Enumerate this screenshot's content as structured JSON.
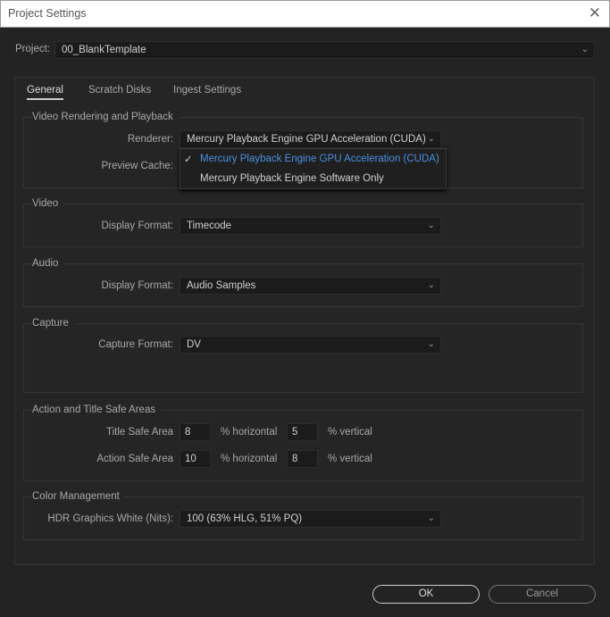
{
  "window": {
    "title": "Project Settings",
    "close_icon": "close-icon"
  },
  "project": {
    "label": "Project:",
    "value": "00_BlankTemplate"
  },
  "tabs": [
    {
      "label": "General",
      "active": true
    },
    {
      "label": "Scratch Disks"
    },
    {
      "label": "Ingest Settings"
    }
  ],
  "video_rendering": {
    "title": "Video Rendering and Playback",
    "renderer_label": "Renderer:",
    "renderer_value": "Mercury Playback Engine GPU Acceleration (CUDA)",
    "preview_cache_label": "Preview Cache:",
    "menu_options": [
      {
        "label": "Mercury Playback Engine GPU Acceleration (CUDA)",
        "selected": true
      },
      {
        "label": "Mercury Playback Engine Software Only"
      }
    ]
  },
  "video": {
    "title": "Video",
    "display_format_label": "Display Format:",
    "display_format_value": "Timecode"
  },
  "audio": {
    "title": "Audio",
    "display_format_label": "Display Format:",
    "display_format_value": "Audio Samples"
  },
  "capture": {
    "title": "Capture",
    "capture_format_label": "Capture Format:",
    "capture_format_value": "DV"
  },
  "safe_areas": {
    "title": "Action and Title Safe Areas",
    "title_safe_label": "Title Safe Area",
    "title_h": "8",
    "title_v": "5",
    "action_safe_label": "Action Safe Area",
    "action_h": "10",
    "action_v": "8",
    "horizontal": "% horizontal",
    "vertical": "% vertical"
  },
  "color": {
    "title": "Color Management",
    "hdr_label": "HDR Graphics White (Nits):",
    "hdr_value": "100 (63% HLG, 51% PQ)"
  },
  "buttons": {
    "ok": "OK",
    "cancel": "Cancel"
  },
  "colors": {
    "accent": "#4a90e2",
    "background": "#232323"
  }
}
